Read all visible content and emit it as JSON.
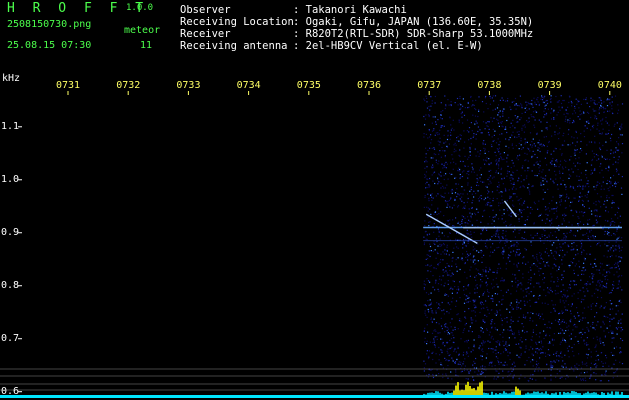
{
  "header": {
    "logo": "H R O F F T",
    "version": "1.0.0",
    "filename": "2508150730.png",
    "meteor_label": "meteor",
    "datetime": "25.08.15 07:30",
    "meteor_count": "11",
    "info": [
      {
        "key": "Observer",
        "value": ": Takanori Kawachi"
      },
      {
        "key": "Receiving Location",
        "value": ": Ogaki, Gifu, JAPAN (136.60E, 35.35N)"
      },
      {
        "key": "Receiver",
        "value": ": R820T2(RTL-SDR) SDR-Sharp 53.1000MHz"
      },
      {
        "key": "Receiving antenna",
        "value": ": 2el-HB9CV Vertical (el. E-W)"
      }
    ]
  },
  "chart_data": {
    "type": "heatmap",
    "ylabel": "kHz",
    "x_ticks": [
      "0731",
      "0732",
      "0733",
      "0734",
      "0735",
      "0736",
      "0737",
      "0738",
      "0739",
      "0740"
    ],
    "y_ticks": [
      "1.1",
      "1.0",
      "0.9",
      "0.8",
      "0.7",
      "0.6"
    ],
    "y_tick_values": [
      1.1,
      1.0,
      0.9,
      0.8,
      0.7,
      0.6
    ],
    "ylim": [
      0.59,
      1.16
    ],
    "data_start_time": "0736.9",
    "carrier_khz": 0.91,
    "meteor_trails": [
      {
        "x_start": 736.95,
        "x_end": 737.8,
        "y_start": 0.935,
        "y_end": 0.88
      },
      {
        "x_start": 738.25,
        "x_end": 738.45,
        "y_start": 0.96,
        "y_end": 0.93
      }
    ],
    "colors": {
      "background": "#000000",
      "noise_low": "#0a0a5a",
      "noise_high": "#3b7bff",
      "signal": "#ffffff",
      "spike": "#ffff00",
      "baseline": "#00e5ff",
      "axis_text": "#ffff66",
      "ytick_text": "#ffffff"
    }
  }
}
